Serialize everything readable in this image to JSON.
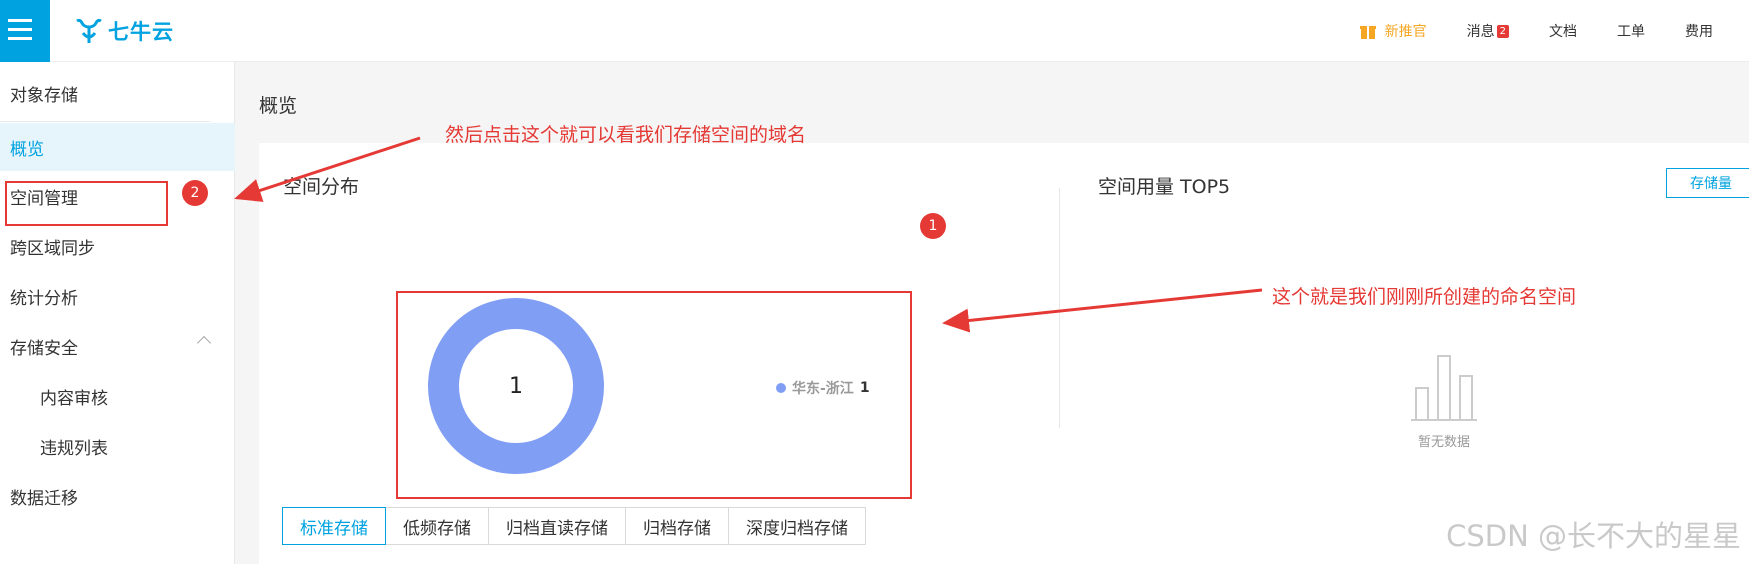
{
  "header": {
    "logo_text": "七牛云",
    "nav": {
      "promo": "新推官",
      "messages": "消息",
      "messages_badge": "2",
      "docs": "文档",
      "tickets": "工单",
      "billing": "费用"
    }
  },
  "sidebar": {
    "title": "对象存储",
    "items": [
      {
        "label": "概览"
      },
      {
        "label": "空间管理"
      },
      {
        "label": "跨区域同步"
      },
      {
        "label": "统计分析"
      },
      {
        "label": "存储安全"
      },
      {
        "label": "内容审核"
      },
      {
        "label": "违规列表"
      },
      {
        "label": "数据迁移"
      }
    ]
  },
  "main": {
    "page_title": "概览",
    "distribution": {
      "title": "空间分布",
      "center_value": "1",
      "legend": [
        {
          "name": "华东-浙江",
          "value": "1"
        }
      ]
    },
    "top5": {
      "title": "空间用量 TOP5",
      "button_label": "存储量",
      "empty_text": "暂无数据"
    },
    "tabs": [
      "标准存储",
      "低频存储",
      "归档直读存储",
      "归档存储",
      "深度归档存储"
    ]
  },
  "annotations": {
    "badge_1": "1",
    "badge_2": "2",
    "note_domain": "然后点击这个就可以看我们存储空间的域名",
    "note_namespace": "这个就是我们刚刚所创建的命名空间"
  },
  "watermark": "CSDN @长不大的星星",
  "colors": {
    "brand": "#00a3e0",
    "donut": "#819ef5",
    "annotation": "#e53935",
    "promo": "#f5a623"
  }
}
